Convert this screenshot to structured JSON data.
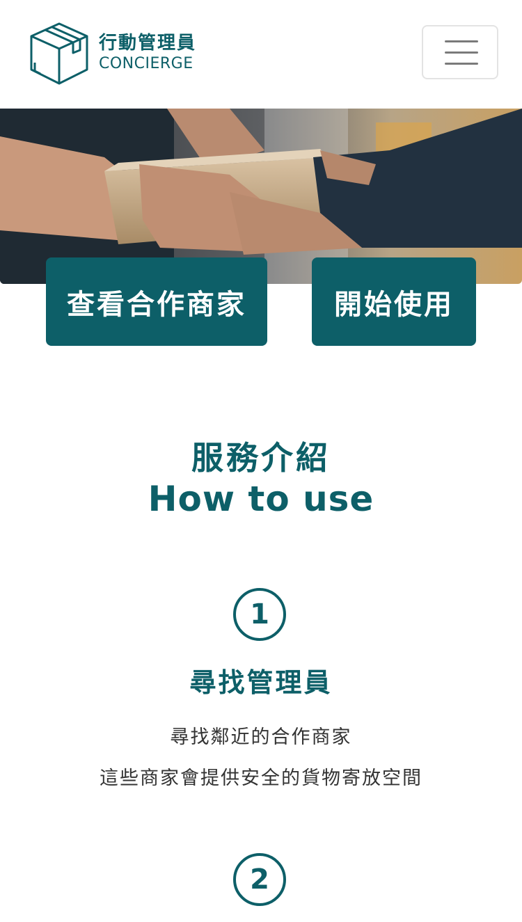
{
  "header": {
    "logo_cn": "行動管理員",
    "logo_en": "CONCIERGE",
    "logo_icon": "box-icon",
    "menu_icon": "hamburger-menu-icon"
  },
  "hero": {
    "image": "hands-passing-cardboard-box-photo"
  },
  "actions": {
    "partners_label": "查看合作商家",
    "start_label": "開始使用"
  },
  "section": {
    "title_cn": "服務介紹",
    "title_en": "How to use"
  },
  "steps": [
    {
      "number": "1",
      "title": "尋找管理員",
      "lines": [
        "尋找鄰近的合作商家",
        "這些商家會提供安全的貨物寄放空間"
      ]
    },
    {
      "number": "2"
    }
  ],
  "colors": {
    "brand": "#0d5f68",
    "button_text": "#ffffff",
    "menu_border": "#e3e3e3"
  }
}
